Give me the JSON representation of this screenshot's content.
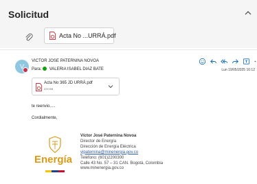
{
  "header": {
    "subject": "Solicitud",
    "attachment_name": "Acta No ...URRÁ.pdf"
  },
  "message": {
    "avatar_initial": "V",
    "sender": "VICTOR JOSE PATERNINA NOVOA",
    "to_label": "Para:",
    "to_name": "VALERIA ISABEL DIAZ BATE",
    "date": "Lun 19/05/2025 16:12",
    "attachment": {
      "name": "Acta No 365 JD URRÁ.pdf",
      "size": "229 KB"
    },
    "body": [
      "te reenvio.....",
      "Cordialmente,"
    ]
  },
  "signature": {
    "name": "Víctor José Paternina Novoa",
    "title": "Director de Energía",
    "department": "Dirección de Energía Eléctrica",
    "email": "vjpaternina@minenergia.gov.co",
    "phone": "Teléfono: (601)2200300",
    "address": "Calle 43 No. 57 – 31 CAN. Bogotá, Colombia",
    "website": "www.minenergia.gov.co",
    "logo_text": "Energía"
  },
  "colors": {
    "accent": "#0f6cbd",
    "pdf_red": "#d13438",
    "presence_green": "#13a10e",
    "avatar_bg": "#8fc7e0",
    "logo_gold": "#d99a18",
    "flag": [
      "#f2c500",
      "#1f3f8f",
      "#c8102e"
    ]
  },
  "icons": {
    "collapse": "chevron-up-icon",
    "attach": "paperclip-icon",
    "pdf": "pdf-file-icon",
    "emoji": "smiley-icon",
    "reply": "reply-icon",
    "reply_all": "reply-all-icon",
    "forward": "forward-icon",
    "teams": "teams-icon",
    "more": "more-icon"
  }
}
